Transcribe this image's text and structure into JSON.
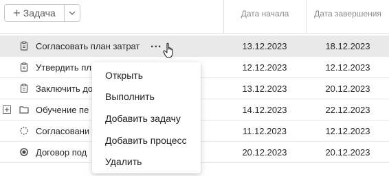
{
  "toolbar": {
    "add_task_label": "Задача"
  },
  "columns": {
    "start": "Дата начала",
    "end": "Дата завершения"
  },
  "rows": [
    {
      "name": "Согласовать план затрат",
      "start": "13.12.2023",
      "end": "18.12.2023",
      "icon": "clipboard-icon",
      "selected": true
    },
    {
      "name": "Утвердить пл",
      "start": "12.12.2023",
      "end": "12.12.2023",
      "icon": "clipboard-icon"
    },
    {
      "name": "Заключить до",
      "start": "13.12.2023",
      "end": "20.12.2023",
      "icon": "clipboard-icon"
    },
    {
      "name": "Обучение пе",
      "start": "14.12.2023",
      "end": "22.12.2023",
      "icon": "folder-icon",
      "expandable": true
    },
    {
      "name": "Согласовани",
      "start": "11.12.2023",
      "end": "12.12.2023",
      "icon": "dashed-circle-icon"
    },
    {
      "name": "Договор под",
      "start": "20.12.2023",
      "end": "20.12.2023",
      "icon": "filled-circle-icon"
    }
  ],
  "context_menu": {
    "items": [
      "Открыть",
      "Выполнить",
      "Добавить задачу",
      "Добавить процесс",
      "Удалить"
    ]
  },
  "row_actions_label": "..."
}
